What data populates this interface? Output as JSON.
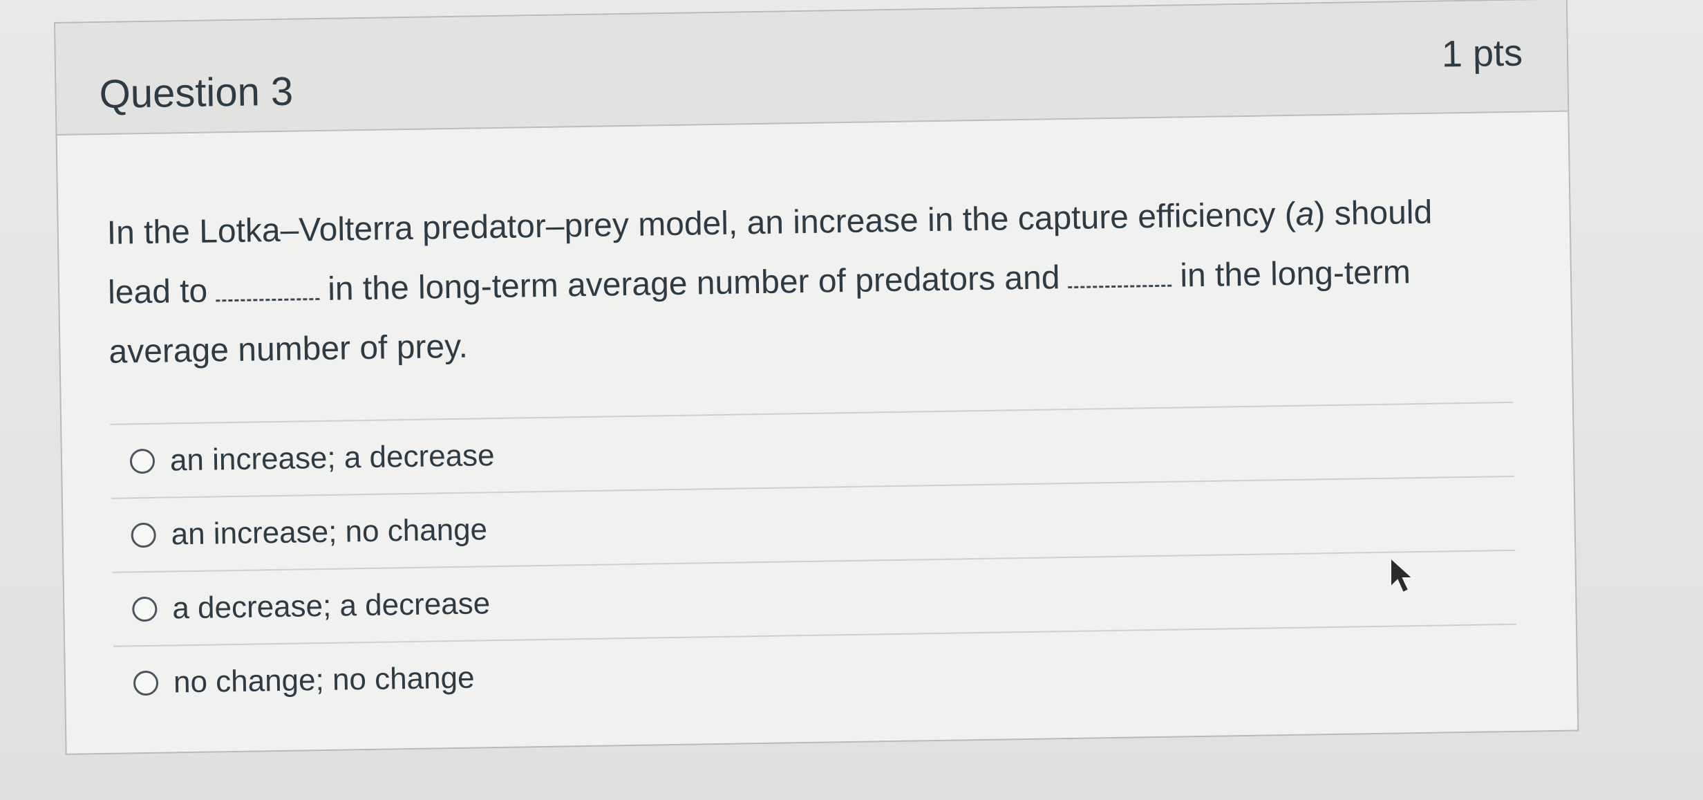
{
  "question": {
    "title": "Question 3",
    "points": "1 pts",
    "text_part1": "In the Lotka–Volterra predator–prey model, an increase in the capture efficiency (",
    "text_var": "a",
    "text_part2": ") should lead to",
    "text_part3": "in the long-term average number of predators and",
    "text_part4": "in the long-term average number of prey."
  },
  "answers": [
    {
      "label": "an increase; a decrease"
    },
    {
      "label": "an increase; no change"
    },
    {
      "label": "a decrease; a decrease"
    },
    {
      "label": "no change; no change"
    }
  ],
  "colors": {
    "text": "#2d3b45",
    "header_bg": "#e2e2e0",
    "card_bg": "#f1f1ef",
    "divider": "#cfcfcd"
  },
  "icons": {
    "cursor": "arrow-pointer-icon"
  }
}
